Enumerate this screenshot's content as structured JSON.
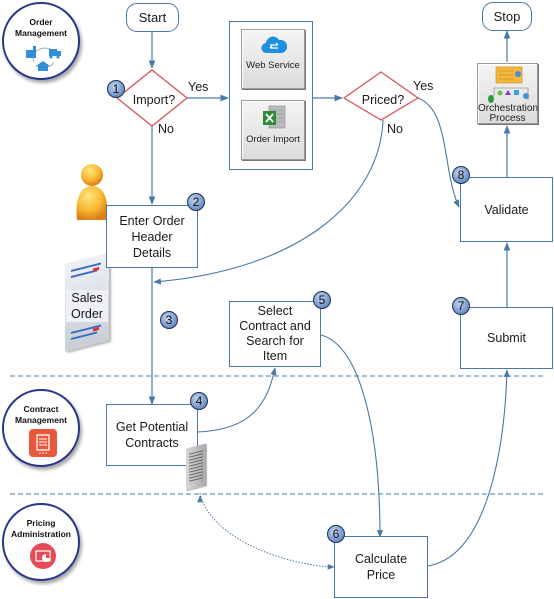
{
  "swimlanes": [
    {
      "id": "order_management",
      "title": "Order Management",
      "icon": "order-management-icon"
    },
    {
      "id": "contract_management",
      "title": "Contract Management",
      "icon": "contract-scroll-icon"
    },
    {
      "id": "pricing_administration",
      "title": "Pricing Administration",
      "icon": "pricing-chart-icon"
    }
  ],
  "terminals": {
    "start": "Start",
    "stop": "Stop"
  },
  "decisions": {
    "import": {
      "label": "Import?",
      "yes": "Yes",
      "no": "No"
    },
    "priced": {
      "label": "Priced?",
      "yes": "Yes",
      "no": "No"
    }
  },
  "import_sources": [
    {
      "label": "Web Service",
      "icon": "cloud-sync-icon"
    },
    {
      "label": "Order Import",
      "icon": "excel-file-icon"
    }
  ],
  "steps": [
    {
      "number": "1",
      "label": "Import?"
    },
    {
      "number": "2",
      "label": "Enter Order Header Details"
    },
    {
      "number": "3",
      "label": ""
    },
    {
      "number": "4",
      "label": "Get Potential Contracts"
    },
    {
      "number": "5",
      "label": "Select Contract and Search for Item"
    },
    {
      "number": "6",
      "label": "Calculate Price"
    },
    {
      "number": "7",
      "label": "Submit"
    },
    {
      "number": "8",
      "label": "Validate"
    }
  ],
  "artifacts": {
    "sales_order": "Sales Order",
    "orchestration": "Orchestration Process"
  },
  "colors": {
    "connector": "#4a79a6",
    "decision_border": "#d9545a",
    "lane_border": "#27358a",
    "badge": "#7d9ed0",
    "contract_icon_bg": "#e9573d",
    "pricing_icon_bg": "#e54b57",
    "om_icon": "#2f8fdc"
  }
}
